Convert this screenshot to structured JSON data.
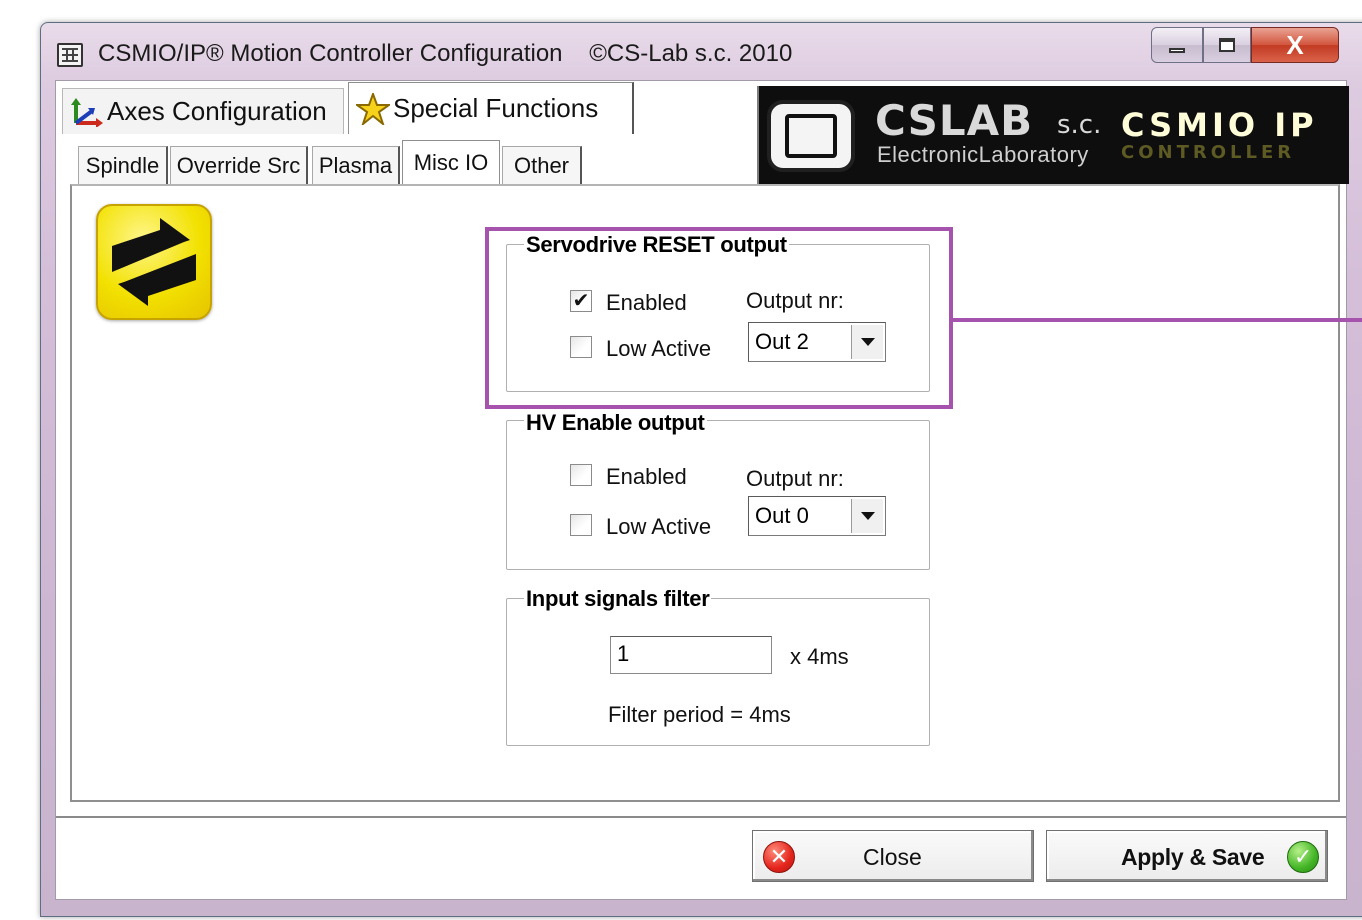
{
  "window": {
    "title": "CSMIO/IP® Motion Controller Configuration    ©CS-Lab s.c. 2010",
    "close_glyph": "X"
  },
  "main_tabs": [
    {
      "label": "Axes Configuration",
      "icon": "axes-icon"
    },
    {
      "label": "Special Functions",
      "icon": "star-icon",
      "active": true
    }
  ],
  "logo": {
    "brand": "CSLAB",
    "suffix": "s.c.",
    "subtitle": "ElectronicLaboratory",
    "product": "CSMIO IP",
    "product_sub": "CONTROLLER"
  },
  "sub_tabs": [
    {
      "label": "Spindle"
    },
    {
      "label": "Override Src"
    },
    {
      "label": "Plasma"
    },
    {
      "label": "Misc IO",
      "active": true
    },
    {
      "label": "Other"
    }
  ],
  "servodrive_reset": {
    "title": "Servodrive RESET output",
    "enabled_label": "Enabled",
    "enabled_checked": true,
    "low_active_label": "Low Active",
    "low_active_checked": false,
    "output_label": "Output nr:",
    "output_value": "Out 2"
  },
  "hv_enable": {
    "title": "HV Enable output",
    "enabled_label": "Enabled",
    "enabled_checked": false,
    "low_active_label": "Low Active",
    "low_active_checked": false,
    "output_label": "Output nr:",
    "output_value": "Out 0"
  },
  "input_filter": {
    "title": "Input signals filter",
    "value": "1",
    "unit": "x 4ms",
    "period_text": "Filter period = 4ms"
  },
  "buttons": {
    "close_label": "Close",
    "apply_label": "Apply & Save"
  },
  "colors": {
    "highlight": "#a653ad",
    "icon_yellow": "#f2e100"
  }
}
